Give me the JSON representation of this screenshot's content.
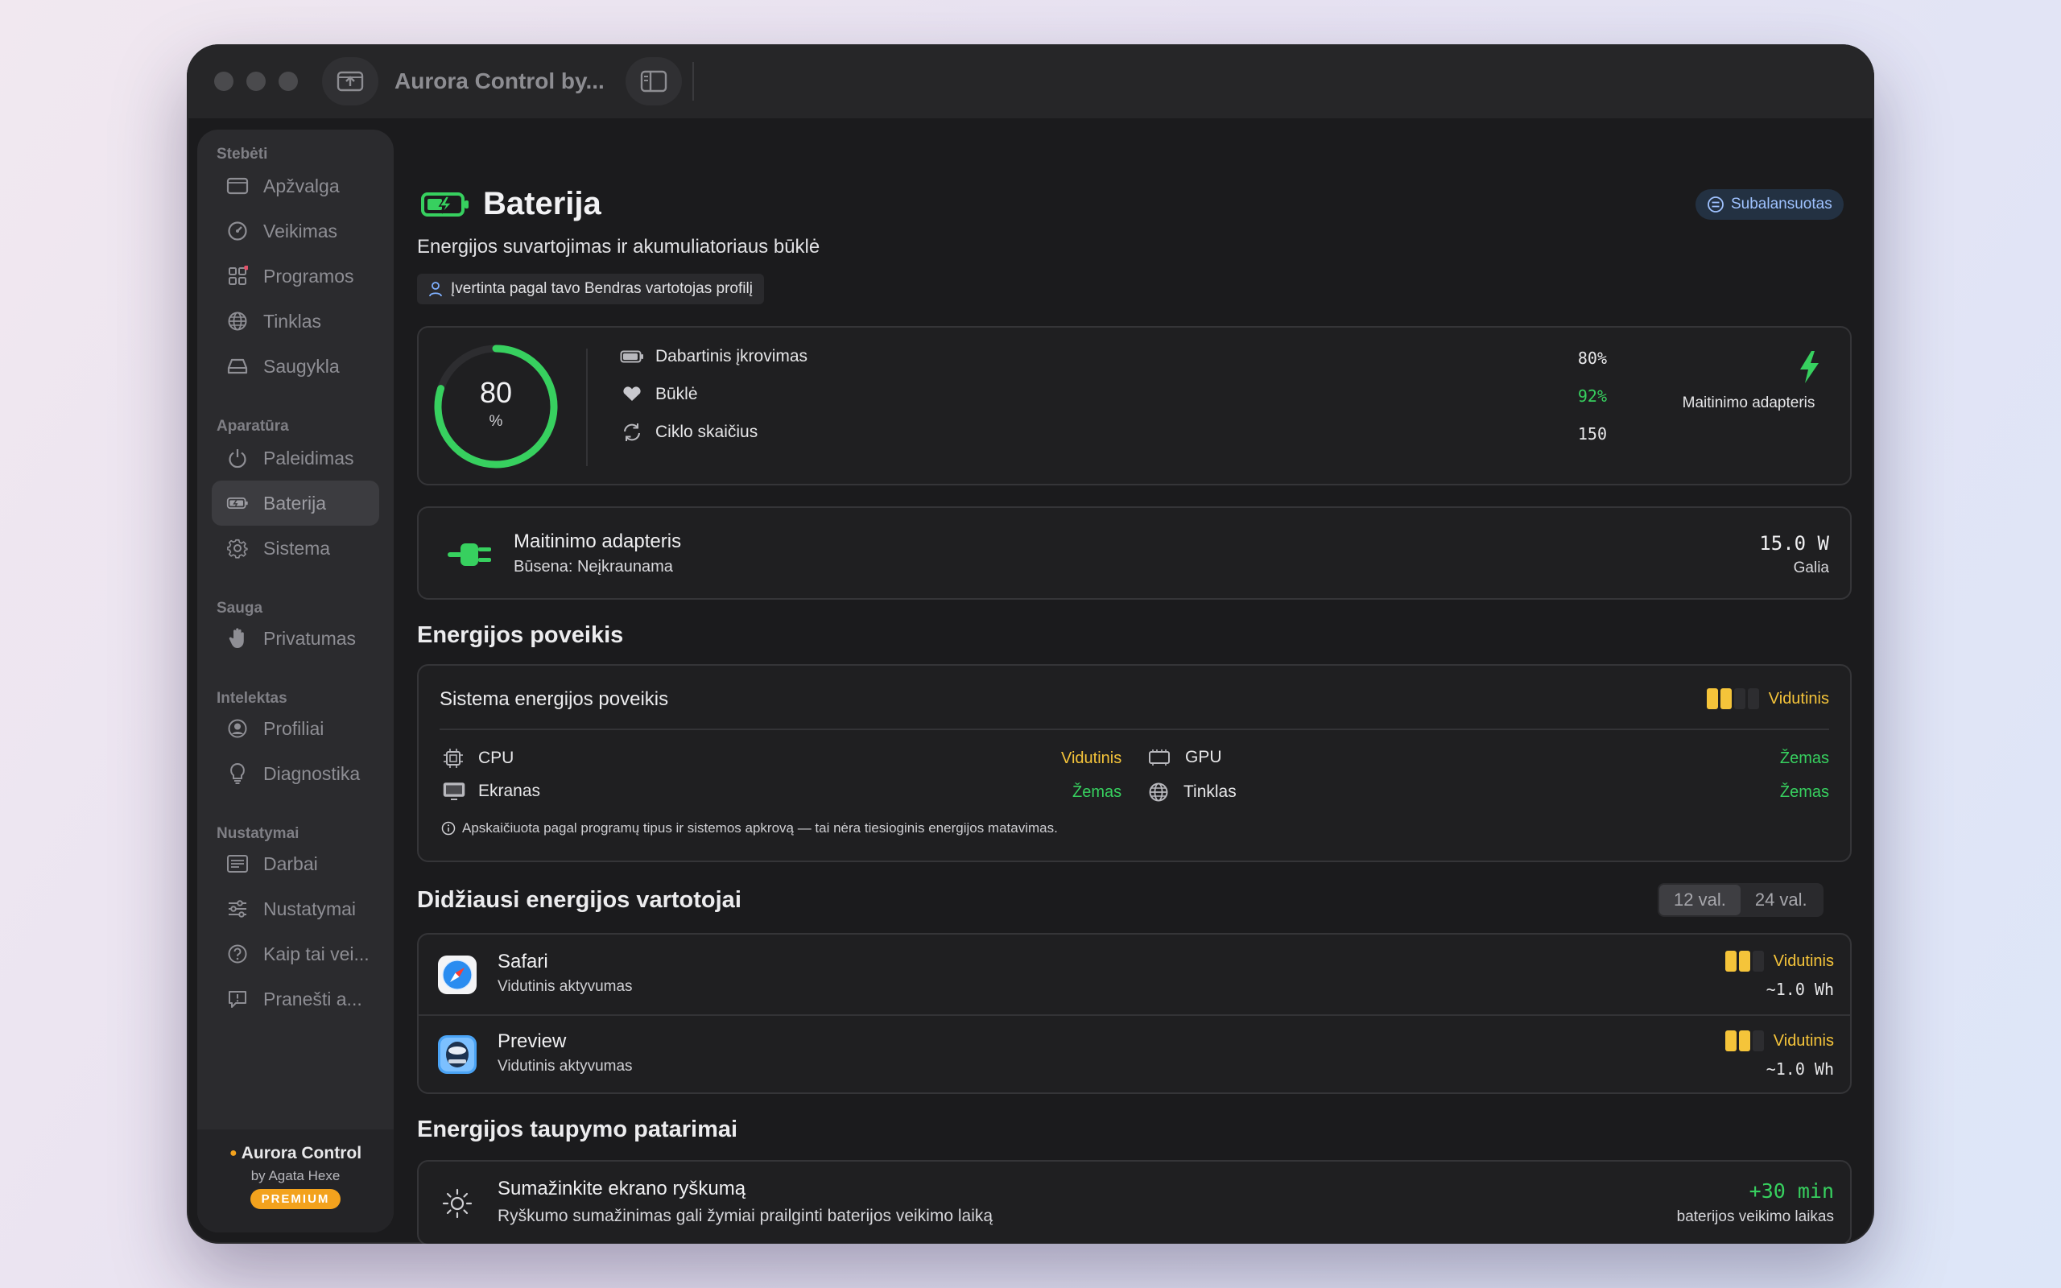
{
  "window": {
    "title": "Aurora Control by..."
  },
  "sidebar": {
    "sections": [
      {
        "label": "Stebėti",
        "items": [
          {
            "label": "Apžvalga",
            "icon": "overview-icon"
          },
          {
            "label": "Veikimas",
            "icon": "gauge-icon"
          },
          {
            "label": "Programos",
            "icon": "apps-grid-icon"
          },
          {
            "label": "Tinklas",
            "icon": "globe-icon"
          },
          {
            "label": "Saugykla",
            "icon": "drive-icon"
          }
        ]
      },
      {
        "label": "Aparatūra",
        "items": [
          {
            "label": "Paleidimas",
            "icon": "power-icon"
          },
          {
            "label": "Baterija",
            "icon": "battery-icon"
          },
          {
            "label": "Sistema",
            "icon": "gear-icon"
          }
        ]
      },
      {
        "label": "Sauga",
        "items": [
          {
            "label": "Privatumas",
            "icon": "hand-icon"
          }
        ]
      },
      {
        "label": "Intelektas",
        "items": [
          {
            "label": "Profiliai",
            "icon": "profile-icon"
          },
          {
            "label": "Diagnostika",
            "icon": "lightbulb-icon"
          }
        ]
      },
      {
        "label": "Nustatymai",
        "items": [
          {
            "label": "Darbai",
            "icon": "list-icon"
          },
          {
            "label": "Nustatymai",
            "icon": "sliders-icon"
          },
          {
            "label": "Kaip tai vei...",
            "icon": "help-icon"
          },
          {
            "label": "Pranešti a...",
            "icon": "report-icon"
          }
        ]
      }
    ],
    "active": "Baterija",
    "footer": {
      "app": "Aurora Control",
      "author": "by Agata Hexe",
      "badge": "PREMIUM"
    }
  },
  "header": {
    "title": "Baterija",
    "subtitle": "Energijos suvartojimas ir akumuliatoriaus būklė",
    "profile_note": "Įvertinta pagal tavo Bendras vartotojas profilį",
    "mode_badge": "Subalansuotas"
  },
  "battery": {
    "percent": "80",
    "percent_unit": "%",
    "level": 0.8,
    "rows": [
      {
        "label": "Dabartinis įkrovimas",
        "value": "80%",
        "icon": "battery-small-icon",
        "color": "#e8e8ea"
      },
      {
        "label": "Būklė",
        "value": "92%",
        "icon": "heart-icon",
        "color": "#37d05f"
      },
      {
        "label": "Ciklo skaičius",
        "value": "150",
        "icon": "cycle-icon",
        "color": "#e8e8ea"
      }
    ],
    "source_label": "Maitinimo adapteris"
  },
  "adapter": {
    "title": "Maitinimo adapteris",
    "status": "Būsena: Neįkraunama",
    "power": "15.0 W",
    "power_label": "Galia"
  },
  "impact": {
    "heading": "Energijos poveikis",
    "system_label": "Sistema energijos poveikis",
    "system_level": "Vidutinis",
    "components": [
      {
        "label": "CPU",
        "value": "Vidutinis",
        "icon": "cpu-icon",
        "color": "#f5c43a"
      },
      {
        "label": "GPU",
        "value": "Žemas",
        "icon": "gpu-icon",
        "color": "#37d05f"
      },
      {
        "label": "Ekranas",
        "value": "Žemas",
        "icon": "display-icon",
        "color": "#37d05f"
      },
      {
        "label": "Tinklas",
        "value": "Žemas",
        "icon": "globe-icon",
        "color": "#37d05f"
      }
    ],
    "note": "Apskaičiuota pagal programų tipus ir sistemos apkrovą — tai nėra tiesioginis energijos matavimas."
  },
  "consumers": {
    "heading": "Didžiausi energijos vartotojai",
    "ranges": [
      "12 val.",
      "24 val."
    ],
    "selected_range": "12 val.",
    "apps": [
      {
        "name": "Safari",
        "activity": "Vidutinis aktyvumas",
        "level": "Vidutinis",
        "energy": "~1.0 Wh",
        "icon": "safari-icon"
      },
      {
        "name": "Preview",
        "activity": "Vidutinis aktyvumas",
        "level": "Vidutinis",
        "energy": "~1.0 Wh",
        "icon": "preview-icon"
      }
    ]
  },
  "tips": {
    "heading": "Energijos taupymo patarimai",
    "items": [
      {
        "title": "Sumažinkite ekrano ryškumą",
        "desc": "Ryškumo sumažinimas gali žymiai prailginti baterijos veikimo laiką",
        "gain": "+30 min",
        "gain_label": "baterijos veikimo laikas",
        "icon": "sun-icon"
      }
    ]
  },
  "colors": {
    "accent_green": "#37d05f",
    "warning_yellow": "#f5c43a",
    "badge_blue": "#9fc2ff",
    "premium_orange": "#f3a21d"
  }
}
